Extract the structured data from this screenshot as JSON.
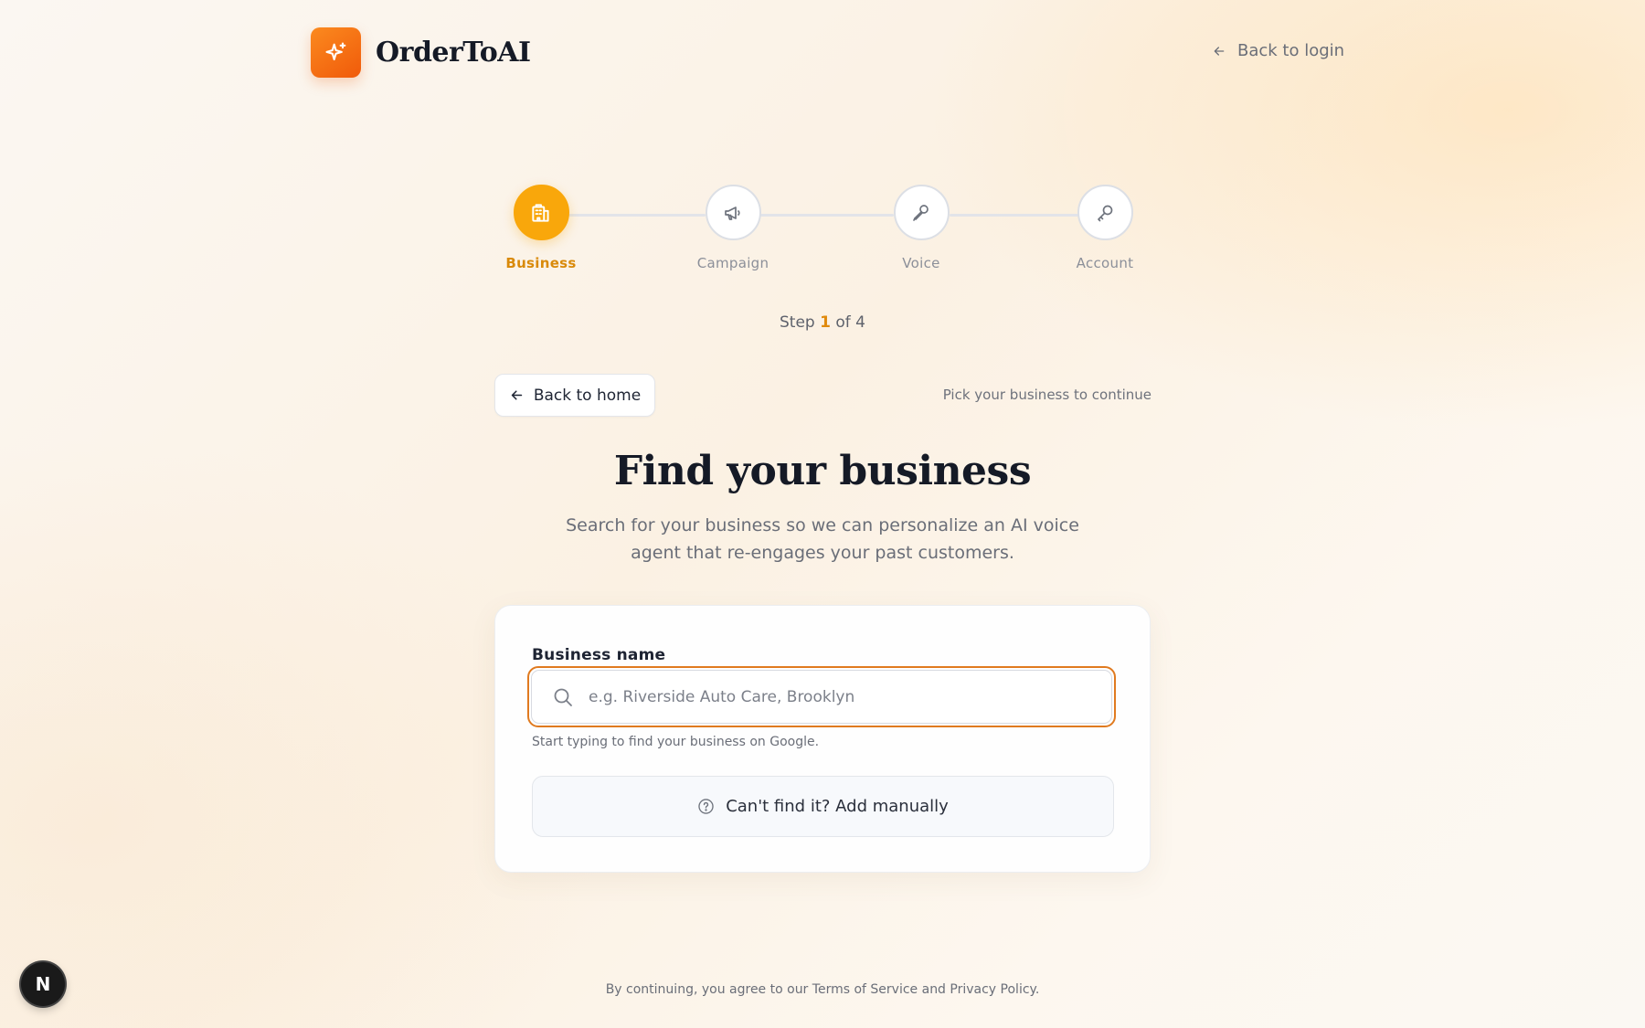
{
  "header": {
    "brand": "OrderToAI",
    "back_login": "Back to login"
  },
  "stepper": {
    "steps": [
      {
        "label": "Business",
        "icon": "building-icon",
        "active": true
      },
      {
        "label": "Campaign",
        "icon": "megaphone-icon",
        "active": false
      },
      {
        "label": "Voice",
        "icon": "microphone-icon",
        "active": false
      },
      {
        "label": "Account",
        "icon": "key-icon",
        "active": false
      }
    ],
    "step_prefix": "Step",
    "current": "1",
    "of_total": "of 4"
  },
  "nav": {
    "back_home": "Back to home",
    "hint": "Pick your business to continue"
  },
  "hero": {
    "title": "Find your business",
    "subtitle": "Search for your business so we can personalize an AI voice agent that re-engages your past customers."
  },
  "form": {
    "label": "Business name",
    "placeholder": "e.g. Riverside Auto Care, Brooklyn",
    "value": "",
    "helper": "Start typing to find your business on Google.",
    "manual_button": "Can't find it? Add manually"
  },
  "footer": {
    "prefix": "By continuing, you agree to our",
    "terms": "Terms of Service",
    "and": "and",
    "privacy": "Privacy Policy",
    "suffix": "."
  },
  "devtools": {
    "badge": "N"
  },
  "colors": {
    "brand_orange": "#f26a0f",
    "active_step": "#f9a70b",
    "focus_ring": "#e07a1f"
  }
}
